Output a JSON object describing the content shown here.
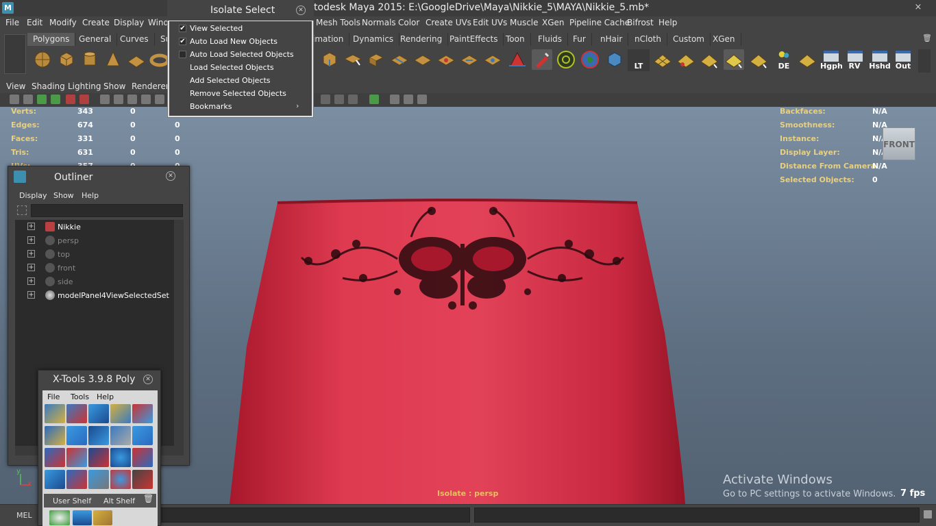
{
  "app": {
    "logo": "M",
    "title": "todesk Maya 2015: E:\\GoogleDrive\\Maya\\Nikkie_5\\MAYA\\Nikkie_5.mb*",
    "close_glyph": "×"
  },
  "menubar": {
    "items": [
      "File",
      "Edit",
      "Modify",
      "Create",
      "Display",
      "Windo",
      "Mesh Tools",
      "Normals",
      "Color",
      "Create UVs",
      "Edit UVs",
      "Muscle",
      "XGen",
      "Pipeline Cache",
      "Bifrost",
      "Help"
    ]
  },
  "shelf": {
    "tabs": [
      "Polygons",
      "General",
      "Curves",
      "Su",
      "imation",
      "Dynamics",
      "Rendering",
      "PaintEffects",
      "Toon",
      "Fluids",
      "Fur",
      "nHair",
      "nCloth",
      "Custom",
      "XGen"
    ],
    "active_tab": "Polygons",
    "text_buttons": [
      "LT",
      "DE",
      "Hgph",
      "RV",
      "Hshd",
      "Out"
    ]
  },
  "panel_menu": {
    "items": [
      "View",
      "Shading",
      "Lighting",
      "Show",
      "Renderer"
    ]
  },
  "hud": {
    "left_rows": [
      {
        "label": "Verts:",
        "v1": "343",
        "v2": "0",
        "v3": "0"
      },
      {
        "label": "Edges:",
        "v1": "674",
        "v2": "0",
        "v3": "0"
      },
      {
        "label": "Faces:",
        "v1": "331",
        "v2": "0",
        "v3": "0"
      },
      {
        "label": "Tris:",
        "v1": "631",
        "v2": "0",
        "v3": "0"
      },
      {
        "label": "UVs:",
        "v1": "357",
        "v2": "0",
        "v3": "0"
      }
    ],
    "right_rows": [
      {
        "label": "Backfaces:",
        "value": "N/A"
      },
      {
        "label": "Smoothness:",
        "value": "N/A"
      },
      {
        "label": "Instance:",
        "value": "N/A"
      },
      {
        "label": "Display Layer:",
        "value": "N/A"
      },
      {
        "label": "Distance From Camera:",
        "value": "N/A"
      },
      {
        "label": "Selected Objects:",
        "value": "0"
      }
    ],
    "viewcube_label": "FRONT",
    "isolate_text": "Isolate : persp",
    "fps": "7 fps",
    "axis_y": "y",
    "axis_x": "x"
  },
  "watermark": {
    "line1": "Activate Windows",
    "line2": "Go to PC settings to activate Windows."
  },
  "isolate_select": {
    "title": "Isolate Select",
    "items": [
      {
        "label": "View Selected",
        "checked": true
      },
      {
        "label": "Auto Load New Objects",
        "checked": true
      },
      {
        "label": "Auto Load Selected Objects",
        "checked": false
      },
      {
        "label": "Load Selected Objects"
      },
      {
        "label": "Add Selected Objects"
      },
      {
        "label": "Remove Selected Objects"
      },
      {
        "label": "Bookmarks",
        "submenu": true
      }
    ],
    "check_glyph": "✔",
    "submenu_glyph": "›"
  },
  "outliner": {
    "title": "Outliner",
    "menu": [
      "Display",
      "Show",
      "Help"
    ],
    "items": [
      {
        "label": "Nikkie",
        "dim": false
      },
      {
        "label": "persp",
        "dim": true
      },
      {
        "label": "top",
        "dim": true
      },
      {
        "label": "front",
        "dim": true
      },
      {
        "label": "side",
        "dim": true
      },
      {
        "label": "modelPanel4ViewSelectedSet",
        "dim": false
      }
    ]
  },
  "xtools": {
    "title": "X-Tools 3.9.8 Poly",
    "menu": [
      "File",
      "Tools",
      "Help"
    ],
    "tabs": [
      "User Shelf",
      "Alt Shelf"
    ]
  },
  "command_line": {
    "label": "MEL"
  }
}
